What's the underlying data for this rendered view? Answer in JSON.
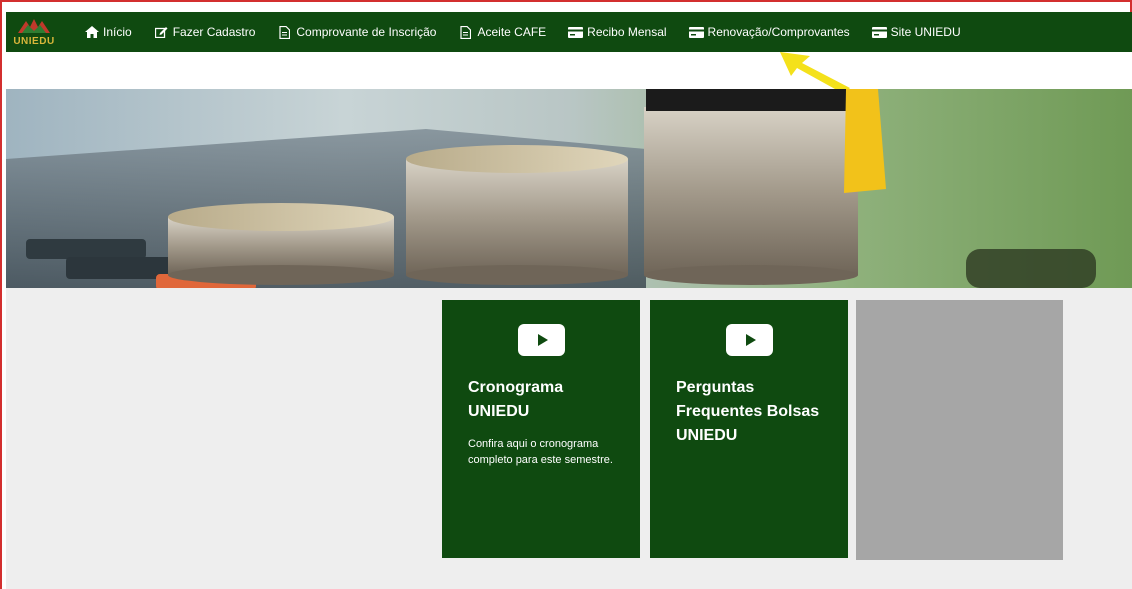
{
  "brand": {
    "logo_text": "UNIEDU"
  },
  "nav": {
    "items": [
      {
        "label": "Início",
        "icon": "home-icon"
      },
      {
        "label": "Fazer Cadastro",
        "icon": "edit-icon"
      },
      {
        "label": "Comprovante de Inscrição",
        "icon": "document-icon"
      },
      {
        "label": "Aceite CAFE",
        "icon": "document-icon"
      },
      {
        "label": "Recibo Mensal",
        "icon": "card-icon"
      },
      {
        "label": "Renovação/Comprovantes",
        "icon": "card-icon"
      },
      {
        "label": "Site UNIEDU",
        "icon": "card-icon"
      }
    ]
  },
  "cards": [
    {
      "title": "Cronograma UNIEDU",
      "description": "Confira aqui o cronograma completo para este semestre.",
      "icon": "play-icon"
    },
    {
      "title": "Perguntas Frequentes Bolsas UNIEDU",
      "description": "",
      "icon": "play-icon"
    }
  ],
  "colors": {
    "nav_bg": "#0f4a10",
    "card_bg": "#0f4a10",
    "accent_arrow": "#f4e11b",
    "frame_border": "#d32f2f"
  }
}
